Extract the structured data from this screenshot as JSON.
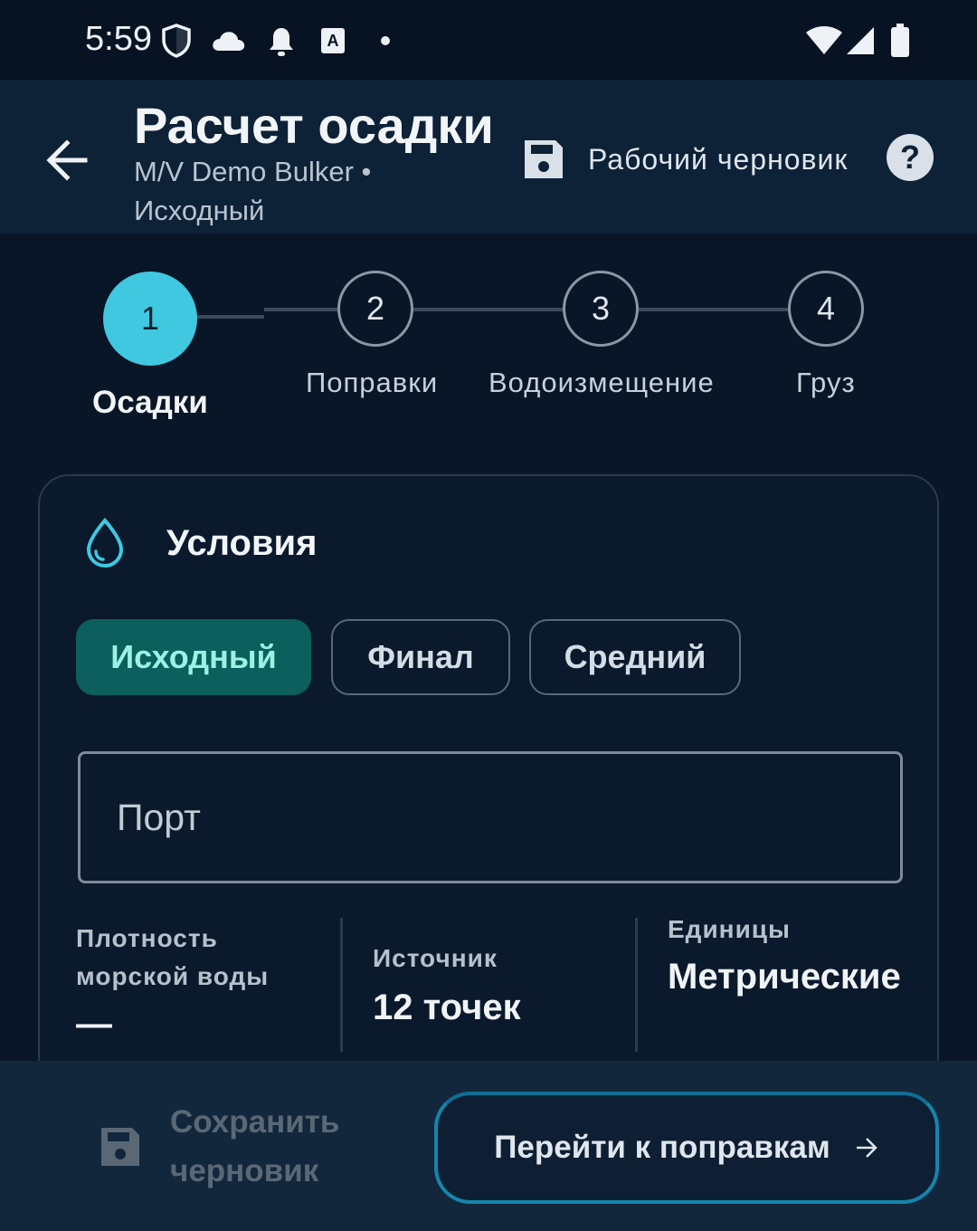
{
  "status_bar": {
    "time": "5:59",
    "left_icons": [
      "shield-icon",
      "cloud-icon",
      "bell-icon",
      "keyboard-a-icon",
      "dot-icon"
    ],
    "right_icons": [
      "wifi-icon",
      "signal-icon",
      "battery-icon"
    ]
  },
  "app_bar": {
    "title": "Расчет осадки",
    "subtitle": "M/V Demo Bulker • Исходный",
    "draft_status": "Рабочий черновик"
  },
  "stepper": {
    "current_step": 1,
    "steps": [
      {
        "number": "1",
        "label": "Осадки"
      },
      {
        "number": "2",
        "label": "Поправки"
      },
      {
        "number": "3",
        "label": "Водоизмещение"
      },
      {
        "number": "4",
        "label": "Груз"
      }
    ]
  },
  "conditions": {
    "title": "Условия",
    "chips": [
      {
        "label": "Исходный",
        "selected": true
      },
      {
        "label": "Финал",
        "selected": false
      },
      {
        "label": "Средний",
        "selected": false
      }
    ],
    "port_placeholder": "Порт",
    "port_value": "",
    "info": [
      {
        "label": "Плотность морской воды",
        "value": "—"
      },
      {
        "label": "Источник",
        "value": "12 точек"
      },
      {
        "label": "Единицы",
        "value": "Метрические"
      }
    ]
  },
  "bottom_bar": {
    "save_draft": "Сохранить черновик",
    "next": "Перейти к поправкам"
  },
  "colors": {
    "background": "#081627",
    "app_bar": "#0d2137",
    "accent": "#3fc8e0",
    "chip_selected_bg": "#0c5f5c",
    "chip_selected_text": "#9df0e4",
    "primary_button_border": "#1585ad"
  }
}
